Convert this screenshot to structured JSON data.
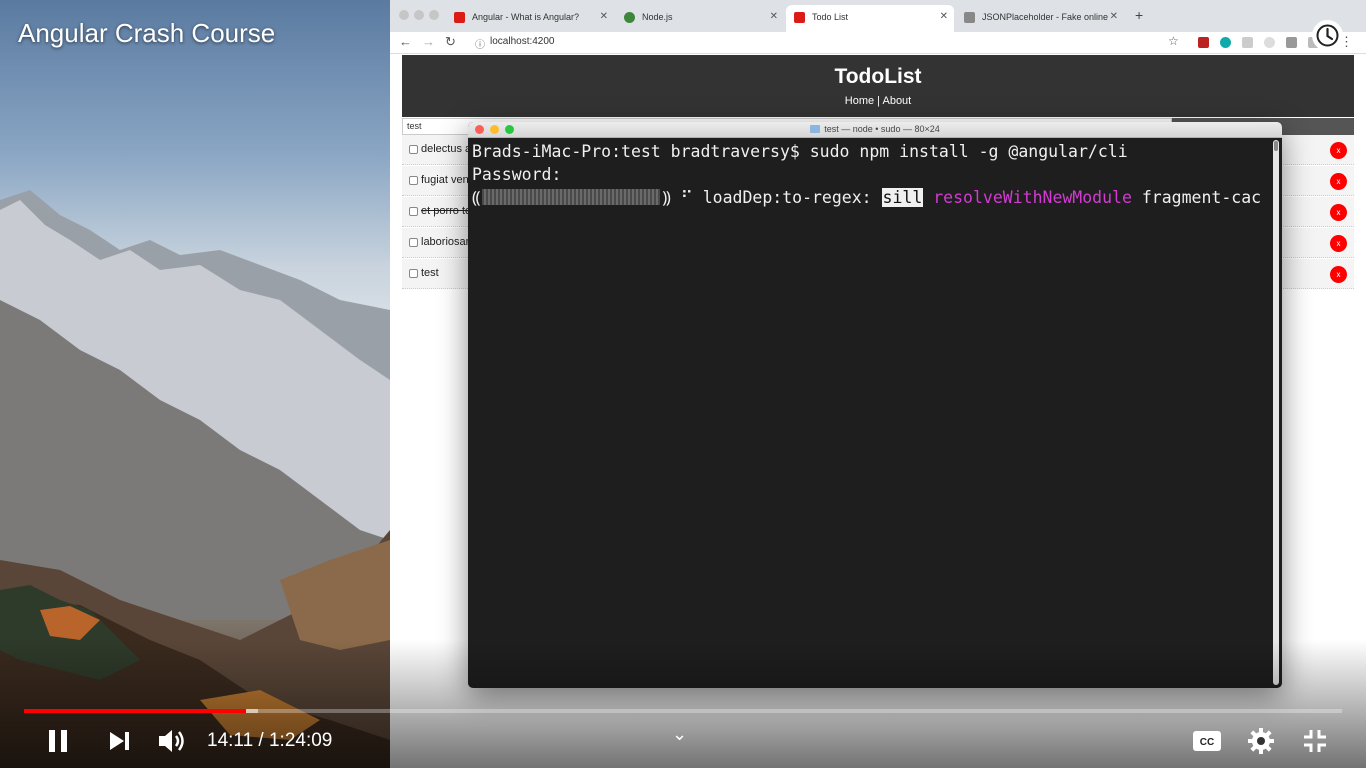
{
  "video": {
    "title": "Angular Crash Course",
    "time_current": "14:11",
    "time_separator": " / ",
    "time_total": "1:24:09",
    "progress_played_fraction": 0.1686,
    "progress_buffered_fraction": 0.1776,
    "cc_label": "CC",
    "accent_color": "#ff0000"
  },
  "browser": {
    "tabs": [
      {
        "label": "Angular - What is Angular?",
        "favicon": "angular-icon",
        "active": false
      },
      {
        "label": "Node.js",
        "favicon": "nodejs-icon",
        "active": false
      },
      {
        "label": "Todo List",
        "favicon": "angular-icon",
        "active": true
      },
      {
        "label": "JSONPlaceholder - Fake online",
        "favicon": "json-icon",
        "active": false
      }
    ],
    "new_tab_label": "+",
    "url": "localhost:4200"
  },
  "app": {
    "title": "TodoList",
    "nav_home": "Home",
    "nav_sep": " | ",
    "nav_about": "About",
    "add_input_value": "test",
    "todos": [
      {
        "title": "delectus aut autem",
        "completed": false
      },
      {
        "title": "fugiat veniam minus",
        "completed": false
      },
      {
        "title": "et porro tempora",
        "completed": true
      },
      {
        "title": "laboriosam mollitia et enim quasi adipisci quia provident illum",
        "completed": false
      },
      {
        "title": "test",
        "completed": false
      }
    ],
    "delete_label": "x"
  },
  "terminal": {
    "title": "test — node • sudo — 80×24",
    "line1": "Brads-iMac-Pro:test bradtraversy$ sudo npm install -g @angular/cli",
    "line2": "Password:",
    "line3_open": "⸨",
    "line3_close": "⸩ ⠋ loadDep:to-regex: ",
    "line3_sill": "sill",
    "line3_magenta": "resolveWithNewModule",
    "line3_rest": " fragment-cac"
  }
}
